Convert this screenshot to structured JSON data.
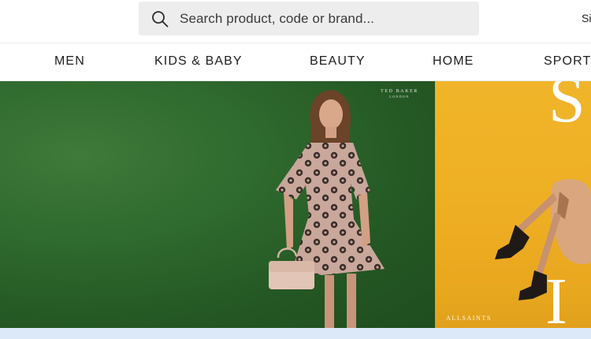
{
  "search": {
    "placeholder": "Search product, code or brand..."
  },
  "header": {
    "signin_label": "Si"
  },
  "nav": {
    "items": [
      "MEN",
      "KIDS & BABY",
      "BEAUTY",
      "HOME",
      "SPORTS"
    ]
  },
  "hero": {
    "left_brand": "TED BAKER",
    "left_brand_sub": "LONDON",
    "right_brand": "ALLSAINTS",
    "right_letter_top": "S",
    "right_letter_bottom": "I"
  },
  "colors": {
    "green_panel": "#2f6a2e",
    "yellow_panel": "#eeae23",
    "strip": "#dbe9f8",
    "search_bg": "#ededed"
  },
  "icons": [
    "search-icon"
  ]
}
